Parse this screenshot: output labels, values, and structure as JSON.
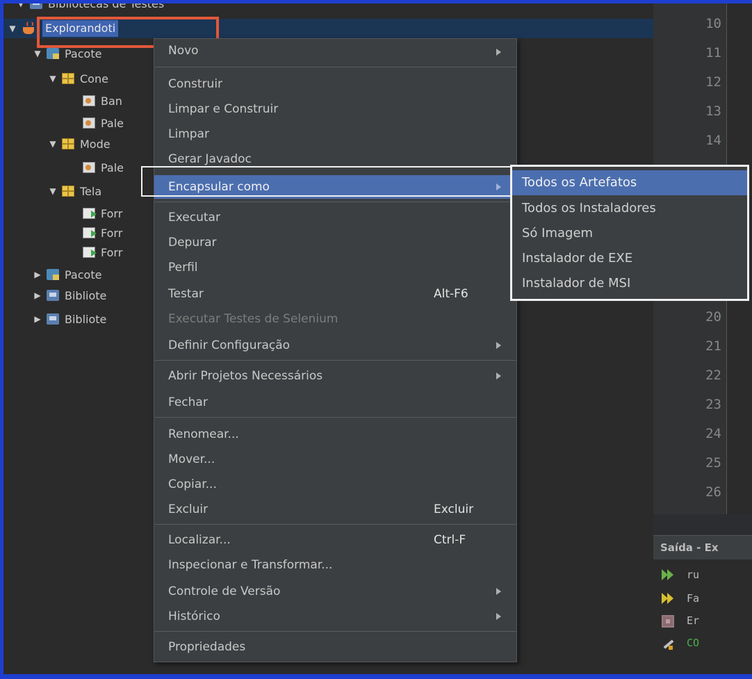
{
  "tree": {
    "partial_top": "Bibliotecas de Testes",
    "project": "Explorandoti",
    "rows": [
      {
        "label": "Pacote",
        "icon": "source-folder-icon"
      },
      {
        "label": "Cone",
        "icon": "package-icon"
      },
      {
        "label": "Ban",
        "icon": "java-class-icon"
      },
      {
        "label": "Pale",
        "icon": "java-class-icon"
      },
      {
        "label": "Mode",
        "icon": "package-icon"
      },
      {
        "label": "Pale",
        "icon": "java-class-icon"
      },
      {
        "label": "Tela",
        "icon": "package-icon"
      },
      {
        "label": "Forr",
        "icon": "form-icon"
      },
      {
        "label": "Forr",
        "icon": "form-icon"
      },
      {
        "label": "Forr",
        "icon": "form-icon"
      },
      {
        "label": "Pacote",
        "icon": "source-folder-icon"
      },
      {
        "label": "Bibliote",
        "icon": "library-icon"
      },
      {
        "label": "Bibliote",
        "icon": "library-icon"
      }
    ]
  },
  "editor": {
    "line_numbers": [
      "10",
      "11",
      "12",
      "13",
      "14",
      "20",
      "21",
      "22",
      "23",
      "24",
      "25",
      "26"
    ]
  },
  "output": {
    "header": "Saída - Ex",
    "lines": [
      "ru",
      "Fa",
      "Er",
      "CO"
    ]
  },
  "context_menu": {
    "items": [
      {
        "label": "Novo",
        "submenu": true
      },
      {
        "label": "Construir"
      },
      {
        "label": "Limpar e Construir"
      },
      {
        "label": "Limpar"
      },
      {
        "label": "Gerar Javadoc"
      },
      {
        "label": "Encapsular como",
        "submenu": true,
        "active": true
      },
      {
        "label": "Executar"
      },
      {
        "label": "Depurar"
      },
      {
        "label": "Perfil"
      },
      {
        "label": "Testar",
        "shortcut": "Alt-F6"
      },
      {
        "label": "Executar Testes de Selenium",
        "disabled": true
      },
      {
        "label": "Definir Configuração",
        "submenu": true
      },
      {
        "label": "Abrir Projetos Necessários",
        "submenu": true
      },
      {
        "label": "Fechar"
      },
      {
        "label": "Renomear..."
      },
      {
        "label": "Mover..."
      },
      {
        "label": "Copiar..."
      },
      {
        "label": "Excluir",
        "shortcut": "Excluir"
      },
      {
        "label": "Localizar...",
        "shortcut": "Ctrl-F"
      },
      {
        "label": "Inspecionar e Transformar..."
      },
      {
        "label": "Controle de Versão",
        "submenu": true
      },
      {
        "label": "Histórico",
        "submenu": true
      },
      {
        "label": "Propriedades"
      }
    ]
  },
  "submenu": {
    "items": [
      {
        "label": "Todos os Artefatos",
        "active": true
      },
      {
        "label": "Todos os Instaladores"
      },
      {
        "label": "Só Imagem"
      },
      {
        "label": "Instalador de EXE"
      },
      {
        "label": "Instalador de MSI"
      }
    ]
  },
  "colors": {
    "frame": "#1e3ed0",
    "menu_bg": "#3c3f41",
    "highlight": "#4b6eaf",
    "annotation_red": "#e0583a"
  }
}
